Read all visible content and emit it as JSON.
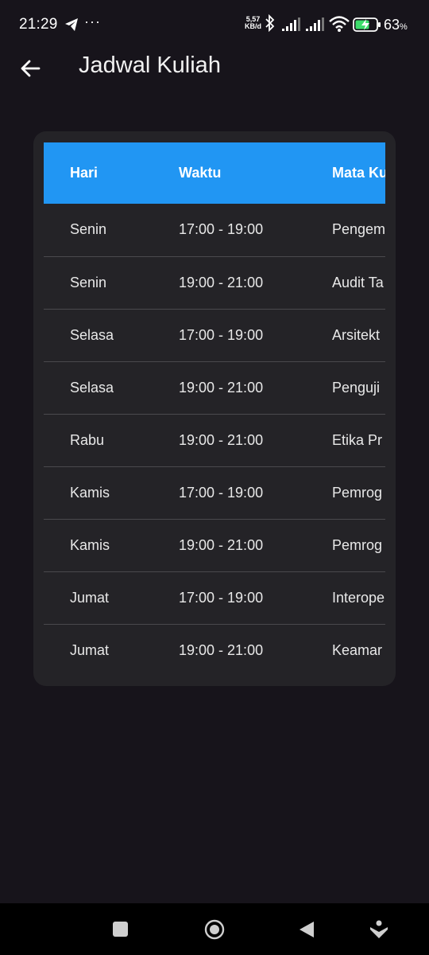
{
  "status_bar": {
    "time": "21:29",
    "dots": "···",
    "speed_value": "5,57",
    "speed_unit": "KB/d",
    "battery_pct": "63",
    "battery_unit": "%"
  },
  "app_bar": {
    "title": "Jadwal Kuliah"
  },
  "table": {
    "headers": [
      "Hari",
      "Waktu",
      "Mata Ku"
    ],
    "rows": [
      [
        "Senin",
        "17:00 - 19:00",
        "Pengem"
      ],
      [
        "Senin",
        "19:00 - 21:00",
        "Audit Ta"
      ],
      [
        "Selasa",
        "17:00 - 19:00",
        "Arsitekt"
      ],
      [
        "Selasa",
        "19:00 - 21:00",
        "Penguji"
      ],
      [
        "Rabu",
        "19:00 - 21:00",
        "Etika Pr"
      ],
      [
        "Kamis",
        "17:00 - 19:00",
        "Pemrog"
      ],
      [
        "Kamis",
        "19:00 - 21:00",
        "Pemrog"
      ],
      [
        "Jumat",
        "17:00 - 19:00",
        "Interope"
      ],
      [
        "Jumat",
        "19:00 - 21:00",
        "Keamar"
      ]
    ]
  },
  "colors": {
    "background": "#17141b",
    "card": "#242327",
    "header": "#2196f3"
  },
  "icons": {
    "status": [
      "telegram-icon",
      "bluetooth-icon",
      "signal-icon",
      "wifi-icon",
      "battery-charging-icon"
    ],
    "app_bar": [
      "back-arrow-icon"
    ],
    "nav": [
      "recents-icon",
      "home-icon",
      "back-icon",
      "accessibility-icon"
    ]
  }
}
